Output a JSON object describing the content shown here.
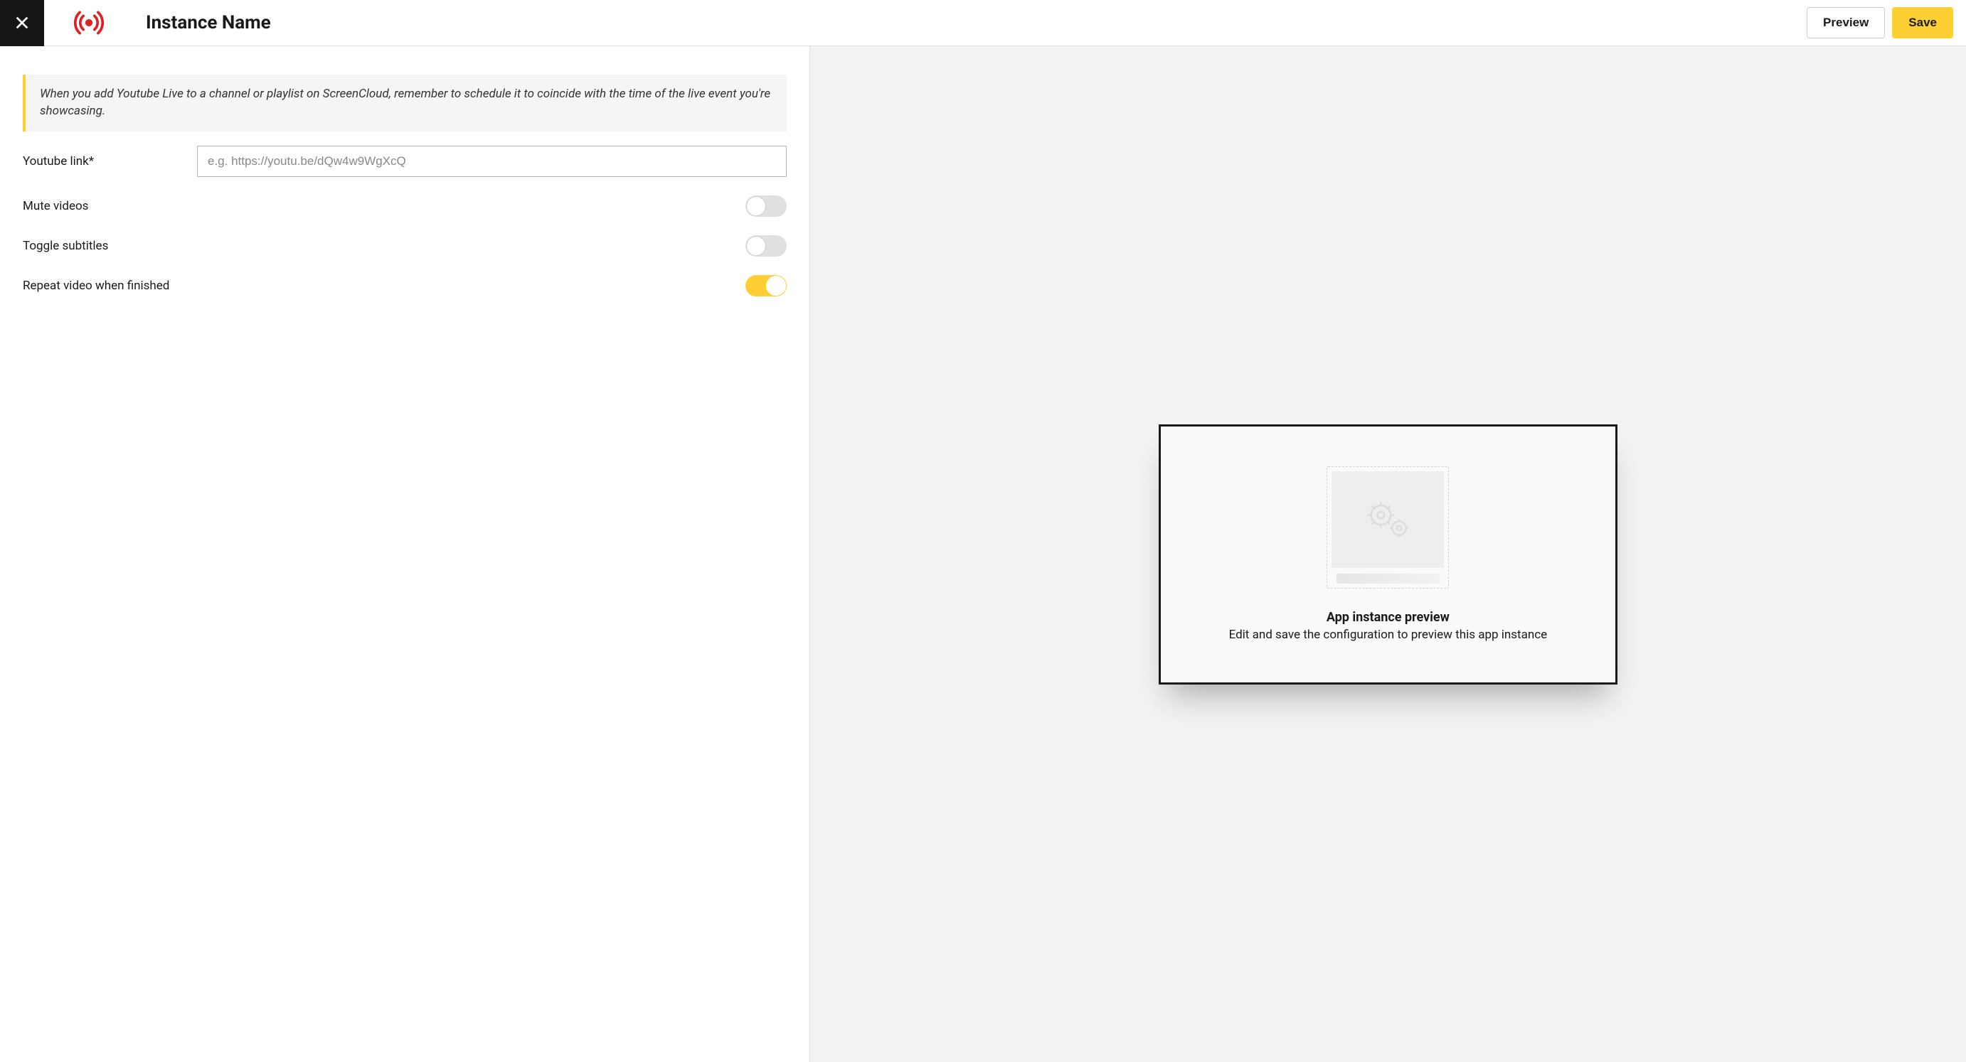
{
  "header": {
    "title": "Instance Name",
    "preview_label": "Preview",
    "save_label": "Save"
  },
  "info": {
    "text": "When you add Youtube Live to a channel or playlist on ScreenCloud, remember to schedule it to coincide with the time of the live event you're showcasing."
  },
  "form": {
    "youtube_link": {
      "label": "Youtube link*",
      "placeholder": "e.g. https://youtu.be/dQw4w9WgXcQ",
      "value": ""
    },
    "mute": {
      "label": "Mute videos",
      "on": false
    },
    "subtitles": {
      "label": "Toggle subtitles",
      "on": false
    },
    "repeat": {
      "label": "Repeat video when finished",
      "on": true
    }
  },
  "preview": {
    "title": "App instance preview",
    "description": "Edit and save the configuration to preview this app instance"
  }
}
